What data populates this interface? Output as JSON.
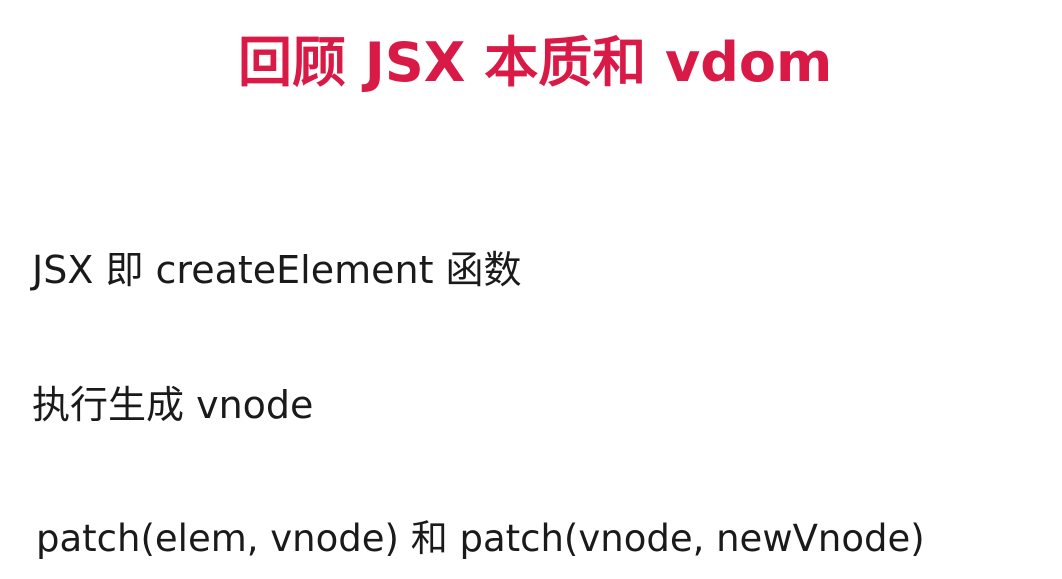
{
  "slide": {
    "title": "回顾 JSX 本质和 vdom",
    "title_color": "#d91a46",
    "bullets": [
      "JSX 即 createElement 函数",
      "执行生成 vnode",
      "patch(elem, vnode) 和 patch(vnode, newVnode)"
    ]
  }
}
